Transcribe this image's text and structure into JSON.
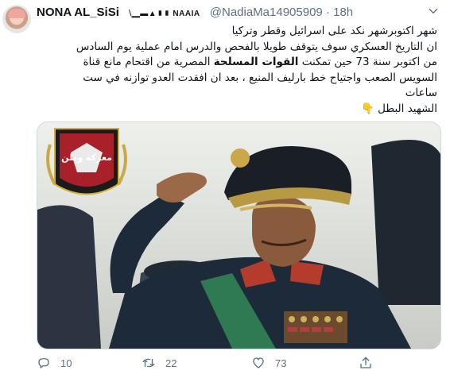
{
  "tweet": {
    "display_name": "NONA AL_SiSi",
    "name_decoration": "⧵▁▬▲▮▮ NAAIA",
    "handle": "@NadiaMa14905909",
    "separator": "·",
    "time": "18h",
    "text_lines": [
      "شهر اكتوبرشهر نكد على اسرائيل وقطر وتركيا",
      "ان التاريخ العسكري سوف يتوقف طويلا بالفحص والدرس امام عملية يوم السادس",
      "من اكتوبر سنة 73 حين تمكنت",
      "القوات المسلحة",
      "المصرية من اقتحام مانع قناة",
      "السويس الصعب واجتياح خط بارليف المنيع ، بعد ان افقدت العدو توازنه في ست",
      "ساعات",
      "الشهيد البطل"
    ],
    "emoji": "👇",
    "media": {
      "badge_text": "معركة وطن",
      "description_icon": "salute-photo"
    },
    "actions": {
      "reply_count": "10",
      "retweet_count": "22",
      "like_count": "73",
      "reply_icon": "reply-icon",
      "retweet_icon": "retweet-icon",
      "like_icon": "heart-icon",
      "share_icon": "share-icon"
    },
    "colors": {
      "muted": "#5b7083",
      "text": "#0f1419"
    }
  }
}
